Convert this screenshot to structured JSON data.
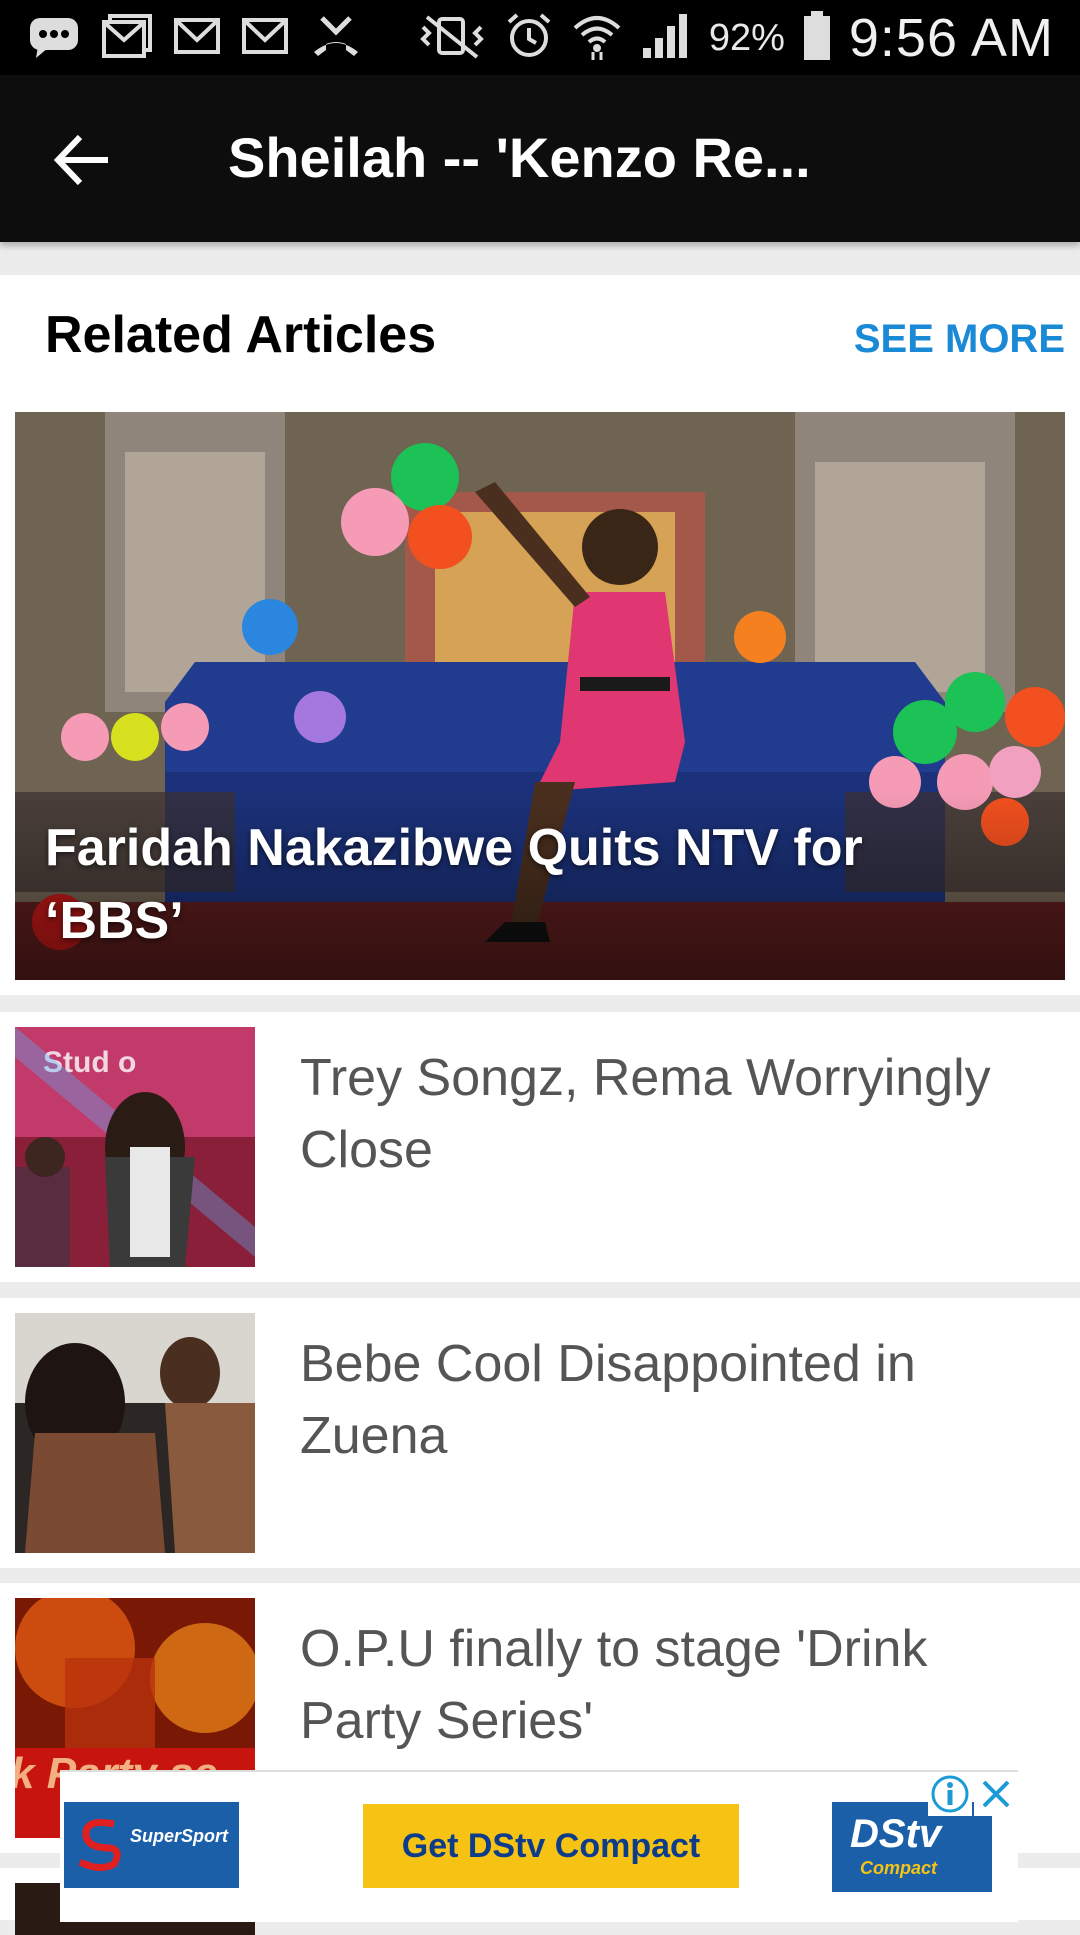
{
  "status_bar": {
    "battery_percent": "92%",
    "time": "9:56 AM",
    "icons": [
      "message-icon",
      "gmail-icon",
      "gmail-icon",
      "gmail-icon",
      "missed-call-icon",
      "vibrate-icon",
      "alarm-icon",
      "wifi-icon",
      "signal-icon",
      "battery-icon"
    ]
  },
  "app_bar": {
    "title": "Sheilah -- 'Kenzo Re...",
    "back_icon": "arrow-back-icon"
  },
  "related": {
    "heading": "Related Articles",
    "see_more": "SEE MORE",
    "featured": {
      "title": "Faridah Nakazibwe Quits NTV for ‘BBS’"
    },
    "items": [
      {
        "title": "Trey Songz, Rema Worryingly Close"
      },
      {
        "title": "Bebe Cool Disappointed in Zuena"
      },
      {
        "title": "O.P.U finally to stage 'Drink Party Series'"
      }
    ]
  },
  "ad": {
    "cta": "Get DStv Compact",
    "left_brand": "SuperSport",
    "right_brand": "DStv",
    "right_brand_sub": "Compact"
  },
  "colors": {
    "accent": "#1a8ad6",
    "app_bar": "#0d0d0d",
    "ad_cta": "#f6c214"
  }
}
